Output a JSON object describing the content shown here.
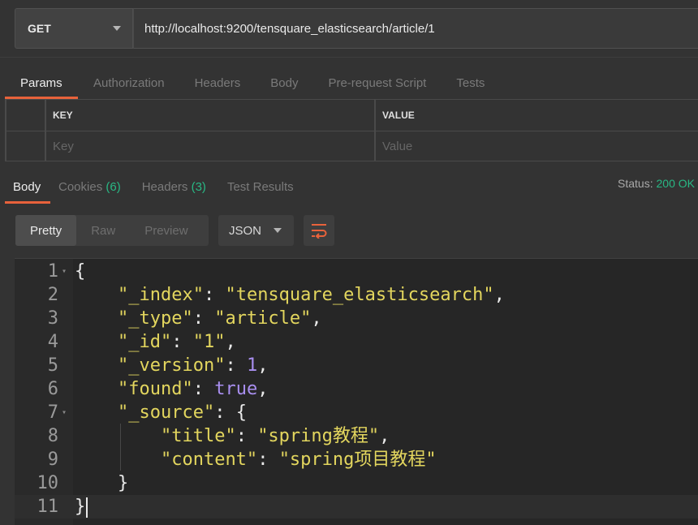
{
  "request": {
    "method": "GET",
    "url": "http://localhost:9200/tensquare_elasticsearch/article/1"
  },
  "request_tabs": [
    "Params",
    "Authorization",
    "Headers",
    "Body",
    "Pre-request Script",
    "Tests"
  ],
  "params": {
    "key_header": "KEY",
    "value_header": "VALUE",
    "key_placeholder": "Key",
    "value_placeholder": "Value"
  },
  "response_tabs": {
    "body": "Body",
    "cookies": "Cookies",
    "cookies_count": "(6)",
    "headers": "Headers",
    "headers_count": "(3)",
    "test_results": "Test Results"
  },
  "status": {
    "label": "Status:",
    "value": "200 OK"
  },
  "format": {
    "pretty": "Pretty",
    "raw": "Raw",
    "preview": "Preview",
    "language": "JSON"
  },
  "code_lines": [
    {
      "n": "1",
      "t": "{"
    },
    {
      "n": "2",
      "t": "    \"_index\": \"tensquare_elasticsearch\","
    },
    {
      "n": "3",
      "t": "    \"_type\": \"article\","
    },
    {
      "n": "4",
      "t": "    \"_id\": \"1\","
    },
    {
      "n": "5",
      "t": "    \"_version\": 1,"
    },
    {
      "n": "6",
      "t": "    \"found\": true,"
    },
    {
      "n": "7",
      "t": "    \"_source\": {"
    },
    {
      "n": "8",
      "t": "        \"title\": \"spring教程\","
    },
    {
      "n": "9",
      "t": "        \"content\": \"spring项目教程\""
    },
    {
      "n": "10",
      "t": "    }"
    },
    {
      "n": "11",
      "t": "}"
    }
  ],
  "colors": {
    "accent": "#e8623b",
    "success": "#29b784",
    "string": "#e3d65e",
    "number": "#a98ff0"
  }
}
